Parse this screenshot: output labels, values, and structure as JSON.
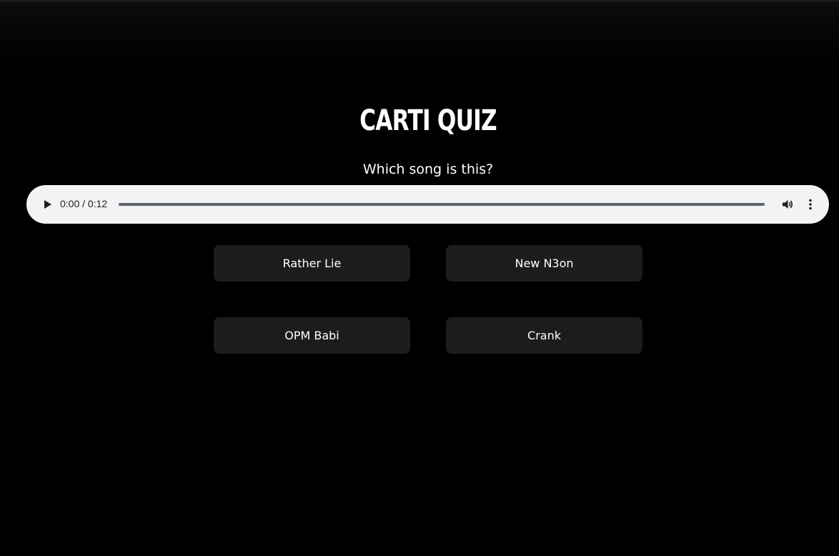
{
  "app": {
    "title": "CARTI QUIZ",
    "question": "Which song is this?"
  },
  "audio_player": {
    "time_display": "0:00 / 0:12",
    "progress": 0,
    "icons": {
      "play": "play-icon",
      "volume": "volume-icon",
      "menu": "more-vert-icon"
    }
  },
  "answers": [
    {
      "label": "Rather Lie"
    },
    {
      "label": "New N3on"
    },
    {
      "label": "OPM Babi"
    },
    {
      "label": "Crank"
    }
  ],
  "colors": {
    "background": "#000000",
    "button_background": "#1c1c1c",
    "player_background": "#f1f3f4",
    "text": "#ffffff"
  }
}
